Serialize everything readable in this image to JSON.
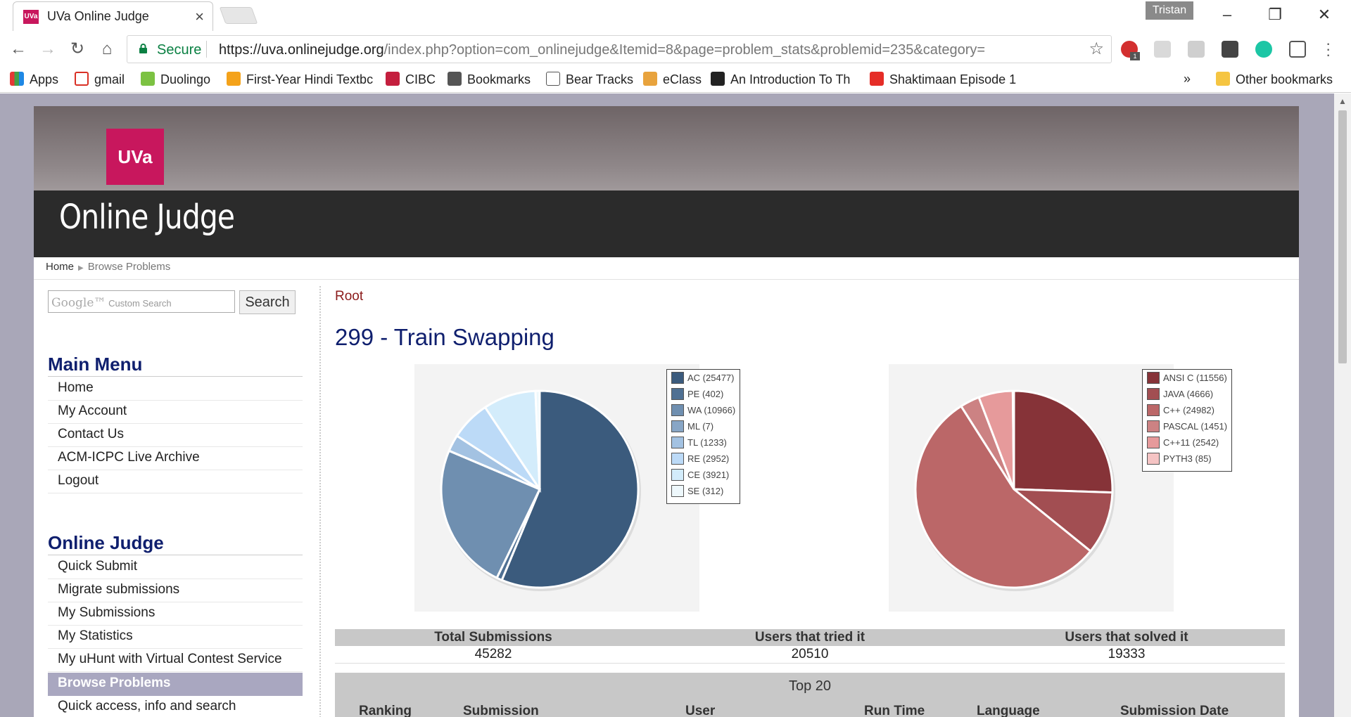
{
  "browser": {
    "tab_title": "UVa Online Judge",
    "tab_favicon_text": "UVa",
    "user": "Tristan",
    "secure_label": "Secure",
    "url_host": "https://uva.onlinejudge.org",
    "url_path": "/index.php?option=com_onlinejudge&Itemid=8&page=problem_stats&problemid=235&category=",
    "bookmarks": [
      "Apps",
      "gmail",
      "Duolingo",
      "First-Year Hindi Textbc",
      "CIBC",
      "Bookmarks",
      "Bear Tracks",
      "eClass",
      "An Introduction To Th",
      "Shaktimaan Episode 1"
    ],
    "overflow": "»",
    "other_bookmarks": "Other bookmarks",
    "ext_badge": "1"
  },
  "site": {
    "logo": "UVa",
    "title": "Online Judge",
    "breadcrumb": [
      "Home",
      "Browse Problems"
    ]
  },
  "sidebar": {
    "search_placeholder": "Custom Search",
    "search_brand": "Google™",
    "search_button": "Search",
    "main_menu_title": "Main Menu",
    "main_menu": [
      "Home",
      "My Account",
      "Contact Us",
      "ACM-ICPC Live Archive",
      "Logout"
    ],
    "oj_menu_title": "Online Judge",
    "oj_menu": [
      "Quick Submit",
      "Migrate submissions",
      "My Submissions",
      "My Statistics",
      "My uHunt with Virtual Contest Service",
      "Browse Problems",
      "Quick access, info and search"
    ],
    "active_item": "Browse Problems"
  },
  "content": {
    "root_link": "Root",
    "problem_title": "299 - Train Swapping"
  },
  "verdict_chart": {
    "legend": [
      "AC (25477)",
      "PE (402)",
      "WA (10966)",
      "ML (7)",
      "TL (1233)",
      "RE (2952)",
      "CE (3921)",
      "SE (312)"
    ],
    "colors": [
      "#3b5b7d",
      "#4f7093",
      "#6f8fb0",
      "#88a6c6",
      "#a3c2e2",
      "#bcdaf7",
      "#d3ecfb",
      "#eef8fc"
    ]
  },
  "language_chart": {
    "legend": [
      "ANSI C (11556)",
      "JAVA (4666)",
      "C++ (24982)",
      "PASCAL (1451)",
      "C++11 (2542)",
      "PYTH3 (85)"
    ],
    "colors": [
      "#863338",
      "#a24e52",
      "#bb6768",
      "#cc8283",
      "#e69a9b",
      "#f5c4c4"
    ]
  },
  "chart_data": [
    {
      "type": "pie",
      "labels": [
        "AC",
        "PE",
        "WA",
        "ML",
        "TL",
        "RE",
        "CE",
        "SE"
      ],
      "values": [
        25477,
        402,
        10966,
        7,
        1233,
        2952,
        3921,
        312
      ]
    },
    {
      "type": "pie",
      "labels": [
        "ANSI C",
        "JAVA",
        "C++",
        "PASCAL",
        "C++11",
        "PYTH3"
      ],
      "values": [
        11556,
        4666,
        24982,
        1451,
        2542,
        85
      ]
    }
  ],
  "stats": {
    "headers": [
      "Total Submissions",
      "Users that tried it",
      "Users that solved it"
    ],
    "values": [
      "45282",
      "20510",
      "19333"
    ]
  },
  "top20": {
    "title": "Top 20",
    "columns": [
      "Ranking",
      "Submission",
      "User",
      "Run Time",
      "Language",
      "Submission Date"
    ]
  }
}
